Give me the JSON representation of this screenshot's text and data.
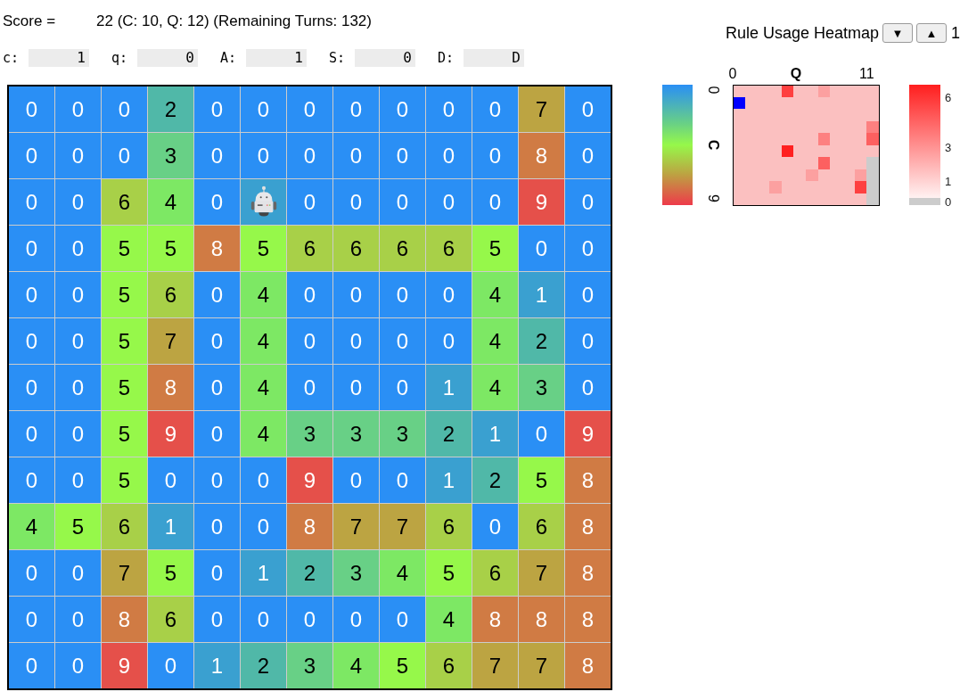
{
  "score": {
    "label": "Score =",
    "value": "22 (C: 10, Q: 12) (Remaining Turns: 132)"
  },
  "fields": [
    {
      "label": "c:",
      "value": "1"
    },
    {
      "label": "q:",
      "value": "0"
    },
    {
      "label": "A:",
      "value": "1"
    },
    {
      "label": "S:",
      "value": "0"
    },
    {
      "label": "D:",
      "value": "D"
    }
  ],
  "grid": {
    "rows": [
      [
        "0",
        "0",
        "0",
        "2",
        "0",
        "0",
        "0",
        "0",
        "0",
        "0",
        "0",
        "7",
        "0"
      ],
      [
        "0",
        "0",
        "0",
        "3",
        "0",
        "0",
        "0",
        "0",
        "0",
        "0",
        "0",
        "8",
        "0"
      ],
      [
        "0",
        "0",
        "6",
        "4",
        "0",
        {
          "kind": "robot",
          "color": "#3aa0d0"
        },
        "0",
        "0",
        "0",
        "0",
        "0",
        "9",
        "0"
      ],
      [
        "0",
        "0",
        "5",
        "5",
        "8",
        "5",
        "6",
        "6",
        "6",
        "6",
        "5",
        "0",
        "0"
      ],
      [
        "0",
        "0",
        "5",
        "6",
        "0",
        "4",
        "0",
        "0",
        "0",
        "0",
        "4",
        "1",
        "0"
      ],
      [
        "0",
        "0",
        "5",
        "7",
        "0",
        "4",
        "0",
        "0",
        "0",
        "0",
        "4",
        "2",
        "0"
      ],
      [
        "0",
        "0",
        "5",
        "8",
        "0",
        "4",
        "0",
        "0",
        "0",
        "1",
        "4",
        "3",
        "0"
      ],
      [
        "0",
        "0",
        "5",
        "9",
        "0",
        "4",
        "3",
        "3",
        "3",
        "2",
        "1",
        "0",
        "9"
      ],
      [
        "0",
        "0",
        "5",
        "0",
        "0",
        "0",
        "9",
        "0",
        "0",
        "1",
        "2",
        "5",
        "8"
      ],
      [
        "4",
        "5",
        "6",
        "1",
        "0",
        "0",
        "8",
        "7",
        "7",
        "6",
        "0",
        "6",
        "8"
      ],
      [
        "0",
        "0",
        "7",
        "5",
        "0",
        "1",
        "2",
        "3",
        "4",
        "5",
        "6",
        "7",
        "8"
      ],
      [
        "0",
        "0",
        "8",
        "6",
        "0",
        "0",
        "0",
        "0",
        "0",
        "4",
        "8",
        "8",
        "8"
      ],
      [
        "0",
        "0",
        "9",
        "0",
        "1",
        "2",
        "3",
        "4",
        "5",
        "6",
        "7",
        "7",
        "8"
      ]
    ]
  },
  "heatmap": {
    "title": "Rule Usage Heatmap",
    "buttons": [
      "▼",
      "▲"
    ],
    "page": "1",
    "x_axis": {
      "title": "Q",
      "labels": [
        "0",
        "11"
      ]
    },
    "y_axis": {
      "title": "C",
      "labels": [
        "0",
        "9"
      ]
    },
    "colorbar_ticks": [
      "6",
      "3",
      "1",
      "0"
    ]
  }
}
